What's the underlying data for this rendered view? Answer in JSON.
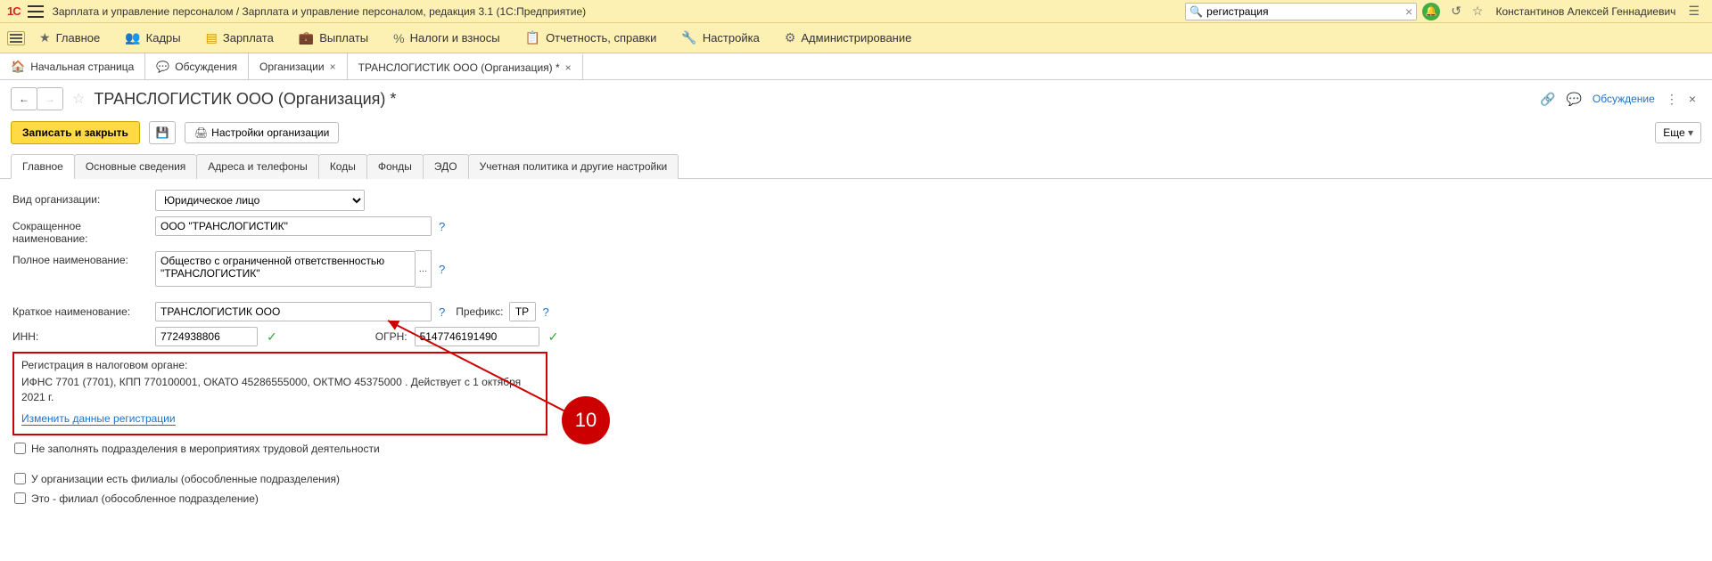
{
  "titlebar": {
    "logo": "1С",
    "title": "Зарплата и управление персоналом / Зарплата и управление персоналом, редакция 3.1  (1С:Предприятие)",
    "search_value": "регистрация",
    "username": "Константинов Алексей Геннадиевич"
  },
  "mainmenu": {
    "items": [
      {
        "icon": "★",
        "label": "Главное"
      },
      {
        "icon": "👥",
        "label": "Кадры"
      },
      {
        "icon": "☰",
        "label": "Зарплата"
      },
      {
        "icon": "💼",
        "label": "Выплаты"
      },
      {
        "icon": "%",
        "label": "Налоги и взносы"
      },
      {
        "icon": "📋",
        "label": "Отчетность, справки"
      },
      {
        "icon": "🔧",
        "label": "Настройка"
      },
      {
        "icon": "⚙",
        "label": "Администрирование"
      }
    ]
  },
  "tabs": {
    "home": "Начальная страница",
    "discussions": "Обсуждения",
    "orgs": "Организации",
    "current": "ТРАНСЛОГИСТИК ООО (Организация) *"
  },
  "page": {
    "title": "ТРАНСЛОГИСТИК ООО (Организация) *",
    "discussion_link": "Обсуждение"
  },
  "toolbar": {
    "save_close": "Записать и закрыть",
    "org_settings": "Настройки организации",
    "more": "Еще"
  },
  "inner_tabs": [
    "Главное",
    "Основные сведения",
    "Адреса и телефоны",
    "Коды",
    "Фонды",
    "ЭДО",
    "Учетная политика и другие настройки"
  ],
  "form": {
    "org_type_label": "Вид организации:",
    "org_type_value": "Юридическое лицо",
    "short_name_label": "Сокращенное наименование:",
    "short_name_value": "ООО \"ТРАНСЛОГИСТИК\"",
    "full_name_label": "Полное наименование:",
    "full_name_value": "Общество с ограниченной ответственностью \"ТРАНСЛОГИСТИК\"",
    "brief_name_label": "Краткое наименование:",
    "brief_name_value": "ТРАНСЛОГИСТИК ООО",
    "prefix_label": "Префикс:",
    "prefix_value": "ТР",
    "inn_label": "ИНН:",
    "inn_value": "7724938806",
    "ogrn_label": "ОГРН:",
    "ogrn_value": "5147746191490",
    "reg_title": "Регистрация в налоговом органе:",
    "reg_body": "ИФНС 7701 (7701), КПП 770100001, ОКАТО 45286555000, ОКТМО 45375000    . Действует с 1 октября 2021 г.",
    "reg_link": "Изменить данные регистрации",
    "cb1": "Не заполнять подразделения в мероприятиях трудовой деятельности",
    "cb2": "У организации есть филиалы (обособленные подразделения)",
    "cb3": "Это - филиал (обособленное подразделение)"
  },
  "annotation": {
    "badge": "10"
  }
}
